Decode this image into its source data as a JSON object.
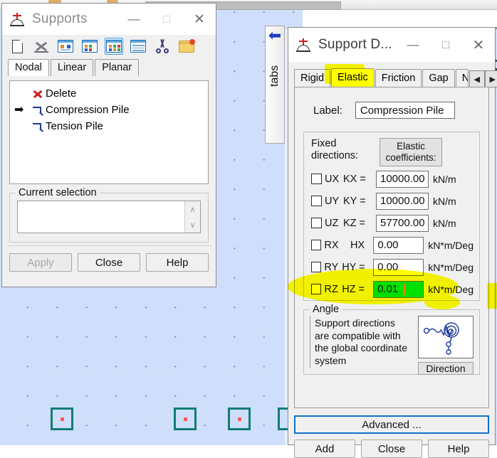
{
  "background": {
    "right_edge_letter": "C",
    "grid_color": "#cfdefa",
    "node_square_color": "#127d72",
    "node_dot_color": "#ff5a5a"
  },
  "side_panel": {
    "label": "tabs",
    "arrow_icon": "left-arrow-icon",
    "arrow_glyph": "⬅"
  },
  "supports_window": {
    "title": "Supports",
    "icon": "support-icon",
    "controls": {
      "minimize": "—",
      "maximize": "□",
      "close": "✕"
    },
    "toolbar": [
      {
        "name": "new-document-icon",
        "label": "New"
      },
      {
        "name": "delete-icon",
        "label": "Delete"
      },
      {
        "name": "large-icons-view-icon",
        "label": "Large icons"
      },
      {
        "name": "small-icons-view-icon",
        "label": "Small icons"
      },
      {
        "name": "list-view-icon",
        "label": "List",
        "selected": true
      },
      {
        "name": "details-view-icon",
        "label": "Details"
      },
      {
        "name": "scissors-icon",
        "label": "Cut"
      },
      {
        "name": "open-folder-icon",
        "label": "Open"
      }
    ],
    "tabs": [
      {
        "label": "Nodal",
        "active": true
      },
      {
        "label": "Linear",
        "active": false
      },
      {
        "label": "Planar",
        "active": false
      }
    ],
    "list_items": [
      {
        "marker": "",
        "icon": "red-x-icon",
        "label": "Delete"
      },
      {
        "marker": "➡",
        "icon": "pile-icon",
        "label": "Compression Pile"
      },
      {
        "marker": "",
        "icon": "pile-icon",
        "label": "Tension Pile"
      }
    ],
    "current_selection": {
      "group_title": "Current selection",
      "value": "",
      "spinner_up": "∧",
      "spinner_down": "∨"
    },
    "buttons": [
      {
        "label": "Apply",
        "disabled": true
      },
      {
        "label": "Close",
        "disabled": false
      },
      {
        "label": "Help",
        "disabled": false
      }
    ]
  },
  "support_definition": {
    "title": "Support D...",
    "icon": "support-icon",
    "controls": {
      "minimize": "—",
      "maximize": "□",
      "close": "✕"
    },
    "tabs": [
      {
        "label": "Rigid",
        "active": false
      },
      {
        "label": "Elastic",
        "active": true
      },
      {
        "label": "Friction",
        "active": false
      },
      {
        "label": "Gap",
        "active": false
      },
      {
        "label": "Nonli",
        "active": false
      }
    ],
    "tab_scroll": {
      "left": "◀",
      "right": "▶"
    },
    "label_caption": "Label:",
    "label_value": "Compression Pile",
    "fixed_directions_caption": "Fixed\ndirections:",
    "fixed_directions_line1": "Fixed",
    "fixed_directions_line2": "directions:",
    "elastic_button_line1": "Elastic",
    "elastic_button_line2": "coefficients:",
    "coefficients": [
      {
        "dir": "UX",
        "coef": "KX =",
        "value": "10000.00",
        "unit": "kN/m",
        "checked": false,
        "focused": false
      },
      {
        "dir": "UY",
        "coef": "KY =",
        "value": "10000.00",
        "unit": "kN/m",
        "checked": false,
        "focused": false
      },
      {
        "dir": "UZ",
        "coef": "KZ =",
        "value": "57700.00",
        "unit": "kN/m",
        "checked": false,
        "focused": false
      },
      {
        "dir": "RX",
        "coef": "HX",
        "value": "0.00",
        "unit": "kN*m/Deg",
        "checked": false,
        "focused": false
      },
      {
        "dir": "RY",
        "coef": "HY =",
        "value": "0.00",
        "unit": "kN*m/Deg",
        "checked": false,
        "focused": false
      },
      {
        "dir": "RZ",
        "coef": "HZ =",
        "value": "0.01",
        "unit": "kN*m/Deg",
        "checked": false,
        "focused": true
      }
    ],
    "angle": {
      "group_title": "Angle",
      "text": "Support directions are compatible with the global coordinate system",
      "direction_button": "Direction",
      "preview_icon": "support-direction-preview-icon"
    },
    "advanced_button": "Advanced ...",
    "buttons": [
      {
        "label": "Add"
      },
      {
        "label": "Close"
      },
      {
        "label": "Help"
      }
    ]
  },
  "annotations": {
    "highlight_color": "#ffff00",
    "focused_field_color": "#00e000",
    "marks": [
      {
        "name": "highlight-elastic-tab",
        "target": "Elastic"
      },
      {
        "name": "highlight-rz-row",
        "target": "RZ HZ = 0.01"
      }
    ]
  }
}
